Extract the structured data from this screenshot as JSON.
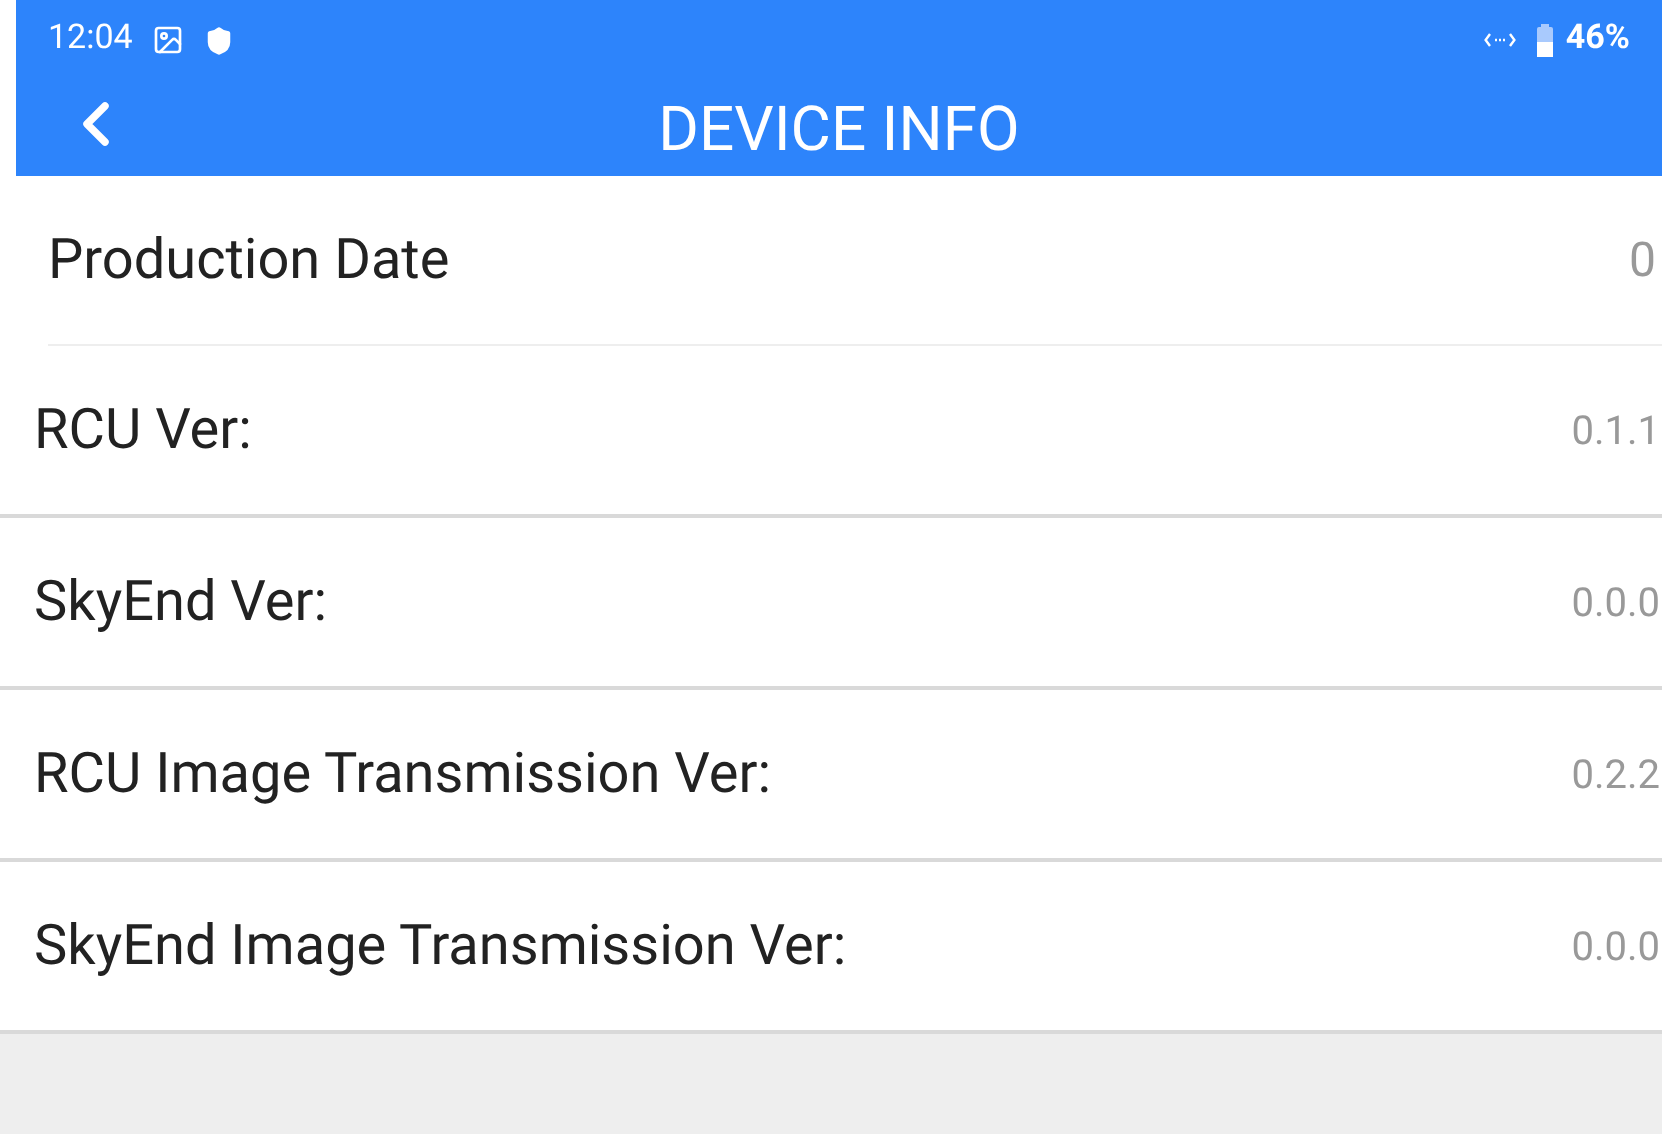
{
  "status_bar": {
    "time": "12:04",
    "battery": "46%"
  },
  "header": {
    "title": "DEVICE INFO"
  },
  "rows": [
    {
      "kind": "section",
      "label": "Production Date",
      "value": "0"
    },
    {
      "kind": "info",
      "label": "RCU Ver:",
      "value": "0.1.1"
    },
    {
      "kind": "info",
      "label": "SkyEnd Ver:",
      "value": "0.0.0"
    },
    {
      "kind": "info",
      "label": "RCU Image Transmission Ver:",
      "value": "0.2.2"
    },
    {
      "kind": "info",
      "label": "SkyEnd Image Transmission Ver:",
      "value": "0.0.0"
    }
  ]
}
